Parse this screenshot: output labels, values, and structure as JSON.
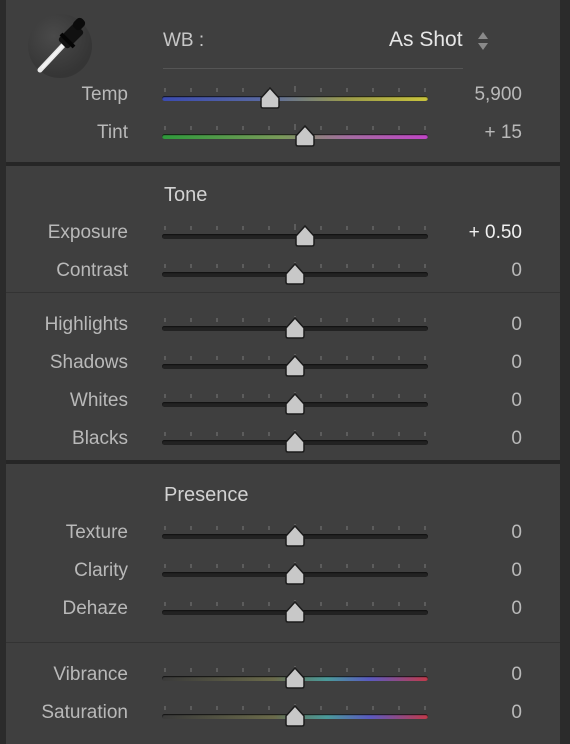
{
  "white_balance": {
    "label": "WB :",
    "value": "As Shot",
    "icons": {
      "eyedropper": "eyedropper-icon",
      "stepper": "up-down-arrows-icon"
    },
    "sliders": [
      {
        "key": "temp",
        "label": "Temp",
        "value": "5,900",
        "level": 0.4,
        "track": "temp"
      },
      {
        "key": "tint",
        "label": "Tint",
        "value": "+ 15",
        "level": 0.54,
        "track": "tint"
      }
    ]
  },
  "tone": {
    "title": "Tone",
    "sliders": [
      {
        "key": "exposure",
        "label": "Exposure",
        "value": "+ 0.50",
        "level": 0.54,
        "track": "plain",
        "highlight": true
      },
      {
        "key": "contrast",
        "label": "Contrast",
        "value": "0",
        "level": 0.5,
        "track": "plain"
      },
      {
        "key": "highlights",
        "label": "Highlights",
        "value": "0",
        "level": 0.5,
        "track": "plain"
      },
      {
        "key": "shadows",
        "label": "Shadows",
        "value": "0",
        "level": 0.5,
        "track": "plain"
      },
      {
        "key": "whites",
        "label": "Whites",
        "value": "0",
        "level": 0.5,
        "track": "plain"
      },
      {
        "key": "blacks",
        "label": "Blacks",
        "value": "0",
        "level": 0.5,
        "track": "plain"
      }
    ]
  },
  "presence": {
    "title": "Presence",
    "sliders": [
      {
        "key": "texture",
        "label": "Texture",
        "value": "0",
        "level": 0.5,
        "track": "plain"
      },
      {
        "key": "clarity",
        "label": "Clarity",
        "value": "0",
        "level": 0.5,
        "track": "plain"
      },
      {
        "key": "dehaze",
        "label": "Dehaze",
        "value": "0",
        "level": 0.5,
        "track": "plain"
      },
      {
        "key": "vibrance",
        "label": "Vibrance",
        "value": "0",
        "level": 0.5,
        "track": "color"
      },
      {
        "key": "saturation",
        "label": "Saturation",
        "value": "0",
        "level": 0.5,
        "track": "color"
      }
    ]
  },
  "colors": {
    "panel_bg": "#3f3f3f",
    "label": "#b9b9b9",
    "value_highlight": "#f0f0f0",
    "thumb": "#c8c8c8"
  }
}
